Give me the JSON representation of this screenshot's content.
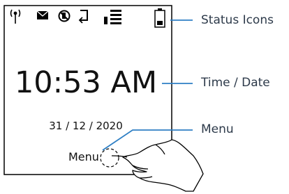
{
  "device": {
    "status_icons": [
      "antenna-icon",
      "envelope-icon",
      "no-phone-icon",
      "forward-icon",
      "signal-bars-icon",
      "battery-icon"
    ],
    "time": "10:53 AM",
    "date": "31 / 12 / 2020",
    "menu_label": "Menu"
  },
  "callouts": {
    "status_icons": "Status Icons",
    "time_date": "Time / Date",
    "menu": "Menu"
  },
  "colors": {
    "screen_border": "#000000",
    "callout_line": "#2e7fc4",
    "callout_text": "#2d3a4a"
  }
}
